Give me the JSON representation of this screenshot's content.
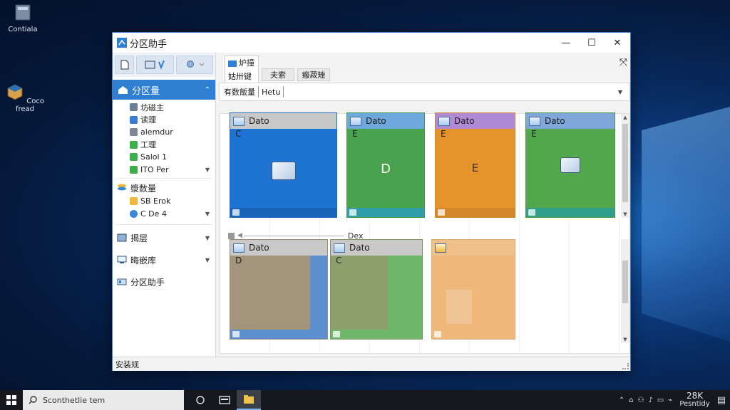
{
  "desktop": {
    "icons": [
      {
        "label": "Contiala"
      },
      {
        "label": "Coco fread"
      }
    ]
  },
  "window": {
    "title": "分区助手",
    "controls": {
      "minimize": "—",
      "maximize": "☐",
      "close": "✕"
    },
    "pin_glyph": "⤧"
  },
  "sidebar": {
    "header": "分区量",
    "sub1": [
      {
        "label": "坊磁主",
        "color": "#6b7f99"
      },
      {
        "label": "读理",
        "color": "#3a7bd5"
      },
      {
        "label": "alemdur",
        "color": "#7d8897"
      },
      {
        "label": "工理",
        "color": "#3fae49"
      },
      {
        "label": "Salol 1",
        "color": "#3fae49"
      },
      {
        "label": "ITO Per",
        "color": "#3fae49"
      }
    ],
    "section2": "漿数量",
    "sub2": [
      {
        "label": "SB Erok",
        "color": "#f0b93a"
      },
      {
        "label": "C De 4",
        "color": "#3a86d8"
      }
    ],
    "sections": [
      {
        "label": "揭层"
      },
      {
        "label": "晦嵌库"
      },
      {
        "label": "分区助手"
      }
    ]
  },
  "tabs": {
    "items": [
      {
        "label": "炉撞",
        "sub": "姑卅键"
      },
      {
        "label": "夫索"
      },
      {
        "label": "瘢菽矬"
      }
    ]
  },
  "address": {
    "label": "有数飯量",
    "value": "Hetu"
  },
  "divider_label": "Dex",
  "cards_top": [
    {
      "title": "Dato",
      "letter": "C",
      "center": "",
      "header_color": "#c8c8c8",
      "body_color": "#1f73d2",
      "footer_color": "#1b63b8"
    },
    {
      "title": "Dato",
      "letter": "E",
      "center": "D",
      "header_color": "#6fa8dc",
      "body_color": "#49a24e",
      "footer_color": "#2f9ea8"
    },
    {
      "title": "Dato",
      "letter": "E",
      "center": "E",
      "header_color": "#b18ad6",
      "body_color": "#e5942c",
      "footer_color": "#d4862a"
    },
    {
      "title": "Dato",
      "letter": "E",
      "center": "",
      "header_color": "#7fa7d9",
      "body_color": "#53a84c",
      "footer_color": "#2f9e8a"
    }
  ],
  "cards_bottom": [
    {
      "title": "Dato",
      "letter": "D",
      "header_color": "#c9c9c9",
      "body_color": "#a3957b",
      "accent_color": "#5b8fcf"
    },
    {
      "title": "Dato",
      "letter": "C",
      "header_color": "#c9c9c9",
      "body_color": "#8ba06c",
      "accent_color": "#6fb86a"
    },
    {
      "title": "",
      "letter": "",
      "header_color": "#efc089",
      "body_color": "#efb77a",
      "accent_color": "#f1c496"
    }
  ],
  "statusbar": {
    "text": "安装规"
  },
  "taskbar": {
    "search_placeholder": "Sconthetlie tem",
    "clock_time": "28K",
    "clock_date": "Pesntidy"
  }
}
